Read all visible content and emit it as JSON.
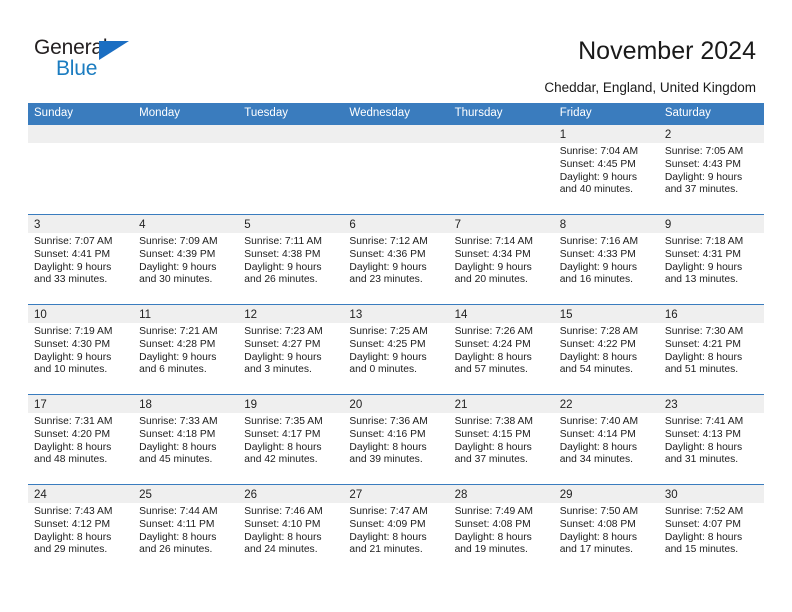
{
  "brand": {
    "name_top": "General",
    "name_bottom": "Blue",
    "color_text": "#231f20",
    "color_accent": "#1b7cc0"
  },
  "header": {
    "title": "November 2024",
    "location": "Cheddar, England, United Kingdom"
  },
  "theme": {
    "header_blue": "#3a7cbe",
    "date_strip": "#efefef",
    "body_text": "#1c1c1c"
  },
  "calendar": {
    "weekday_headers": [
      "Sunday",
      "Monday",
      "Tuesday",
      "Wednesday",
      "Thursday",
      "Friday",
      "Saturday"
    ],
    "weeks": [
      [
        {
          "day": "",
          "sunrise": "",
          "sunset": "",
          "daylight1": "",
          "daylight2": ""
        },
        {
          "day": "",
          "sunrise": "",
          "sunset": "",
          "daylight1": "",
          "daylight2": ""
        },
        {
          "day": "",
          "sunrise": "",
          "sunset": "",
          "daylight1": "",
          "daylight2": ""
        },
        {
          "day": "",
          "sunrise": "",
          "sunset": "",
          "daylight1": "",
          "daylight2": ""
        },
        {
          "day": "",
          "sunrise": "",
          "sunset": "",
          "daylight1": "",
          "daylight2": ""
        },
        {
          "day": "1",
          "sunrise": "Sunrise: 7:04 AM",
          "sunset": "Sunset: 4:45 PM",
          "daylight1": "Daylight: 9 hours",
          "daylight2": "and 40 minutes."
        },
        {
          "day": "2",
          "sunrise": "Sunrise: 7:05 AM",
          "sunset": "Sunset: 4:43 PM",
          "daylight1": "Daylight: 9 hours",
          "daylight2": "and 37 minutes."
        }
      ],
      [
        {
          "day": "3",
          "sunrise": "Sunrise: 7:07 AM",
          "sunset": "Sunset: 4:41 PM",
          "daylight1": "Daylight: 9 hours",
          "daylight2": "and 33 minutes."
        },
        {
          "day": "4",
          "sunrise": "Sunrise: 7:09 AM",
          "sunset": "Sunset: 4:39 PM",
          "daylight1": "Daylight: 9 hours",
          "daylight2": "and 30 minutes."
        },
        {
          "day": "5",
          "sunrise": "Sunrise: 7:11 AM",
          "sunset": "Sunset: 4:38 PM",
          "daylight1": "Daylight: 9 hours",
          "daylight2": "and 26 minutes."
        },
        {
          "day": "6",
          "sunrise": "Sunrise: 7:12 AM",
          "sunset": "Sunset: 4:36 PM",
          "daylight1": "Daylight: 9 hours",
          "daylight2": "and 23 minutes."
        },
        {
          "day": "7",
          "sunrise": "Sunrise: 7:14 AM",
          "sunset": "Sunset: 4:34 PM",
          "daylight1": "Daylight: 9 hours",
          "daylight2": "and 20 minutes."
        },
        {
          "day": "8",
          "sunrise": "Sunrise: 7:16 AM",
          "sunset": "Sunset: 4:33 PM",
          "daylight1": "Daylight: 9 hours",
          "daylight2": "and 16 minutes."
        },
        {
          "day": "9",
          "sunrise": "Sunrise: 7:18 AM",
          "sunset": "Sunset: 4:31 PM",
          "daylight1": "Daylight: 9 hours",
          "daylight2": "and 13 minutes."
        }
      ],
      [
        {
          "day": "10",
          "sunrise": "Sunrise: 7:19 AM",
          "sunset": "Sunset: 4:30 PM",
          "daylight1": "Daylight: 9 hours",
          "daylight2": "and 10 minutes."
        },
        {
          "day": "11",
          "sunrise": "Sunrise: 7:21 AM",
          "sunset": "Sunset: 4:28 PM",
          "daylight1": "Daylight: 9 hours",
          "daylight2": "and 6 minutes."
        },
        {
          "day": "12",
          "sunrise": "Sunrise: 7:23 AM",
          "sunset": "Sunset: 4:27 PM",
          "daylight1": "Daylight: 9 hours",
          "daylight2": "and 3 minutes."
        },
        {
          "day": "13",
          "sunrise": "Sunrise: 7:25 AM",
          "sunset": "Sunset: 4:25 PM",
          "daylight1": "Daylight: 9 hours",
          "daylight2": "and 0 minutes."
        },
        {
          "day": "14",
          "sunrise": "Sunrise: 7:26 AM",
          "sunset": "Sunset: 4:24 PM",
          "daylight1": "Daylight: 8 hours",
          "daylight2": "and 57 minutes."
        },
        {
          "day": "15",
          "sunrise": "Sunrise: 7:28 AM",
          "sunset": "Sunset: 4:22 PM",
          "daylight1": "Daylight: 8 hours",
          "daylight2": "and 54 minutes."
        },
        {
          "day": "16",
          "sunrise": "Sunrise: 7:30 AM",
          "sunset": "Sunset: 4:21 PM",
          "daylight1": "Daylight: 8 hours",
          "daylight2": "and 51 minutes."
        }
      ],
      [
        {
          "day": "17",
          "sunrise": "Sunrise: 7:31 AM",
          "sunset": "Sunset: 4:20 PM",
          "daylight1": "Daylight: 8 hours",
          "daylight2": "and 48 minutes."
        },
        {
          "day": "18",
          "sunrise": "Sunrise: 7:33 AM",
          "sunset": "Sunset: 4:18 PM",
          "daylight1": "Daylight: 8 hours",
          "daylight2": "and 45 minutes."
        },
        {
          "day": "19",
          "sunrise": "Sunrise: 7:35 AM",
          "sunset": "Sunset: 4:17 PM",
          "daylight1": "Daylight: 8 hours",
          "daylight2": "and 42 minutes."
        },
        {
          "day": "20",
          "sunrise": "Sunrise: 7:36 AM",
          "sunset": "Sunset: 4:16 PM",
          "daylight1": "Daylight: 8 hours",
          "daylight2": "and 39 minutes."
        },
        {
          "day": "21",
          "sunrise": "Sunrise: 7:38 AM",
          "sunset": "Sunset: 4:15 PM",
          "daylight1": "Daylight: 8 hours",
          "daylight2": "and 37 minutes."
        },
        {
          "day": "22",
          "sunrise": "Sunrise: 7:40 AM",
          "sunset": "Sunset: 4:14 PM",
          "daylight1": "Daylight: 8 hours",
          "daylight2": "and 34 minutes."
        },
        {
          "day": "23",
          "sunrise": "Sunrise: 7:41 AM",
          "sunset": "Sunset: 4:13 PM",
          "daylight1": "Daylight: 8 hours",
          "daylight2": "and 31 minutes."
        }
      ],
      [
        {
          "day": "24",
          "sunrise": "Sunrise: 7:43 AM",
          "sunset": "Sunset: 4:12 PM",
          "daylight1": "Daylight: 8 hours",
          "daylight2": "and 29 minutes."
        },
        {
          "day": "25",
          "sunrise": "Sunrise: 7:44 AM",
          "sunset": "Sunset: 4:11 PM",
          "daylight1": "Daylight: 8 hours",
          "daylight2": "and 26 minutes."
        },
        {
          "day": "26",
          "sunrise": "Sunrise: 7:46 AM",
          "sunset": "Sunset: 4:10 PM",
          "daylight1": "Daylight: 8 hours",
          "daylight2": "and 24 minutes."
        },
        {
          "day": "27",
          "sunrise": "Sunrise: 7:47 AM",
          "sunset": "Sunset: 4:09 PM",
          "daylight1": "Daylight: 8 hours",
          "daylight2": "and 21 minutes."
        },
        {
          "day": "28",
          "sunrise": "Sunrise: 7:49 AM",
          "sunset": "Sunset: 4:08 PM",
          "daylight1": "Daylight: 8 hours",
          "daylight2": "and 19 minutes."
        },
        {
          "day": "29",
          "sunrise": "Sunrise: 7:50 AM",
          "sunset": "Sunset: 4:08 PM",
          "daylight1": "Daylight: 8 hours",
          "daylight2": "and 17 minutes."
        },
        {
          "day": "30",
          "sunrise": "Sunrise: 7:52 AM",
          "sunset": "Sunset: 4:07 PM",
          "daylight1": "Daylight: 8 hours",
          "daylight2": "and 15 minutes."
        }
      ]
    ]
  }
}
